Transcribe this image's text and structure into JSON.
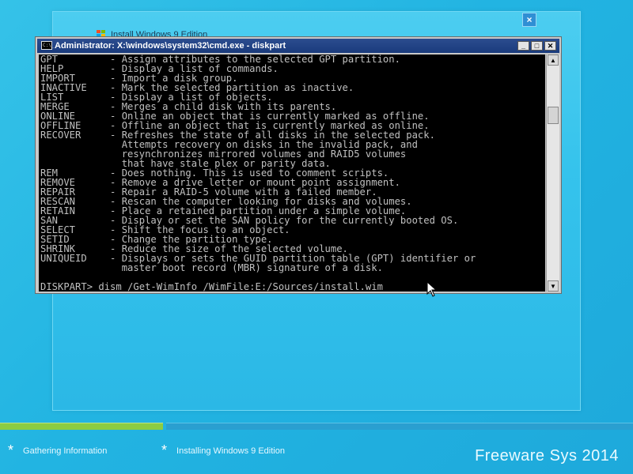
{
  "setup_window": {
    "title": "Install Windows 9 Edition",
    "close_label": "×"
  },
  "cmd_window": {
    "title": "Administrator: X:\\windows\\system32\\cmd.exe - diskpart",
    "icon_text": "C:\\_",
    "buttons": {
      "minimize": "_",
      "maximize": "□",
      "close": "✕"
    },
    "lines": [
      "GPT         - Assign attributes to the selected GPT partition.",
      "HELP        - Display a list of commands.",
      "IMPORT      - Import a disk group.",
      "INACTIVE    - Mark the selected partition as inactive.",
      "LIST        - Display a list of objects.",
      "MERGE       - Merges a child disk with its parents.",
      "ONLINE      - Online an object that is currently marked as offline.",
      "OFFLINE     - Offline an object that is currently marked as online.",
      "RECOVER     - Refreshes the state of all disks in the selected pack.",
      "              Attempts recovery on disks in the invalid pack, and",
      "              resynchronizes mirrored volumes and RAID5 volumes",
      "              that have stale plex or parity data.",
      "REM         - Does nothing. This is used to comment scripts.",
      "REMOVE      - Remove a drive letter or mount point assignment.",
      "REPAIR      - Repair a RAID-5 volume with a failed member.",
      "RESCAN      - Rescan the computer looking for disks and volumes.",
      "RETAIN      - Place a retained partition under a simple volume.",
      "SAN         - Display or set the SAN policy for the currently booted OS.",
      "SELECT      - Shift the focus to an object.",
      "SETID       - Change the partition type.",
      "SHRINK      - Reduce the size of the selected volume.",
      "UNIQUEID    - Displays or sets the GUID partition table (GPT) identifier or",
      "              master boot record (MBR) signature of a disk.",
      "",
      "DISKPART> dism /Get-WimInfo /WimFile:E:/Sources/install.wim"
    ]
  },
  "progress": {
    "steps": [
      {
        "label": "Gathering Information",
        "fill": 1.0
      },
      {
        "label": "Installing Windows 9 Edition",
        "fill": 0.0
      }
    ]
  },
  "footer": {
    "brand": "Freeware Sys 2014",
    "step_icon": "*"
  },
  "colors": {
    "background": "#22b4e2",
    "progress_done": "#8ccc42",
    "progress_todo": "#2a9fd0",
    "title_bar": "#1a3b7c",
    "console_bg": "#000000",
    "console_text": "#c0c0c0"
  }
}
